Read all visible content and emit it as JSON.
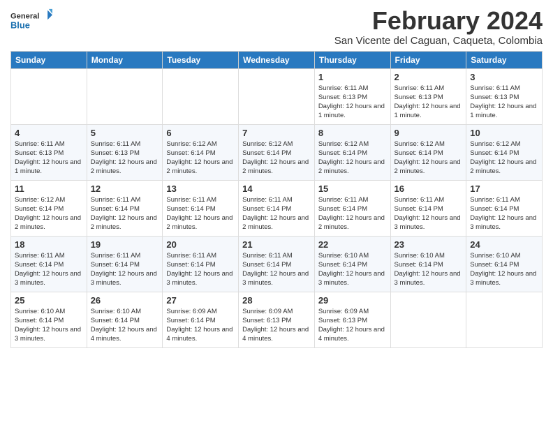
{
  "logo": {
    "line1": "General",
    "line2": "Blue"
  },
  "title": "February 2024",
  "subtitle": "San Vicente del Caguan, Caqueta, Colombia",
  "days_of_week": [
    "Sunday",
    "Monday",
    "Tuesday",
    "Wednesday",
    "Thursday",
    "Friday",
    "Saturday"
  ],
  "weeks": [
    [
      {
        "day": "",
        "info": ""
      },
      {
        "day": "",
        "info": ""
      },
      {
        "day": "",
        "info": ""
      },
      {
        "day": "",
        "info": ""
      },
      {
        "day": "1",
        "info": "Sunrise: 6:11 AM\nSunset: 6:13 PM\nDaylight: 12 hours and 1 minute."
      },
      {
        "day": "2",
        "info": "Sunrise: 6:11 AM\nSunset: 6:13 PM\nDaylight: 12 hours and 1 minute."
      },
      {
        "day": "3",
        "info": "Sunrise: 6:11 AM\nSunset: 6:13 PM\nDaylight: 12 hours and 1 minute."
      }
    ],
    [
      {
        "day": "4",
        "info": "Sunrise: 6:11 AM\nSunset: 6:13 PM\nDaylight: 12 hours and 1 minute."
      },
      {
        "day": "5",
        "info": "Sunrise: 6:11 AM\nSunset: 6:13 PM\nDaylight: 12 hours and 2 minutes."
      },
      {
        "day": "6",
        "info": "Sunrise: 6:12 AM\nSunset: 6:14 PM\nDaylight: 12 hours and 2 minutes."
      },
      {
        "day": "7",
        "info": "Sunrise: 6:12 AM\nSunset: 6:14 PM\nDaylight: 12 hours and 2 minutes."
      },
      {
        "day": "8",
        "info": "Sunrise: 6:12 AM\nSunset: 6:14 PM\nDaylight: 12 hours and 2 minutes."
      },
      {
        "day": "9",
        "info": "Sunrise: 6:12 AM\nSunset: 6:14 PM\nDaylight: 12 hours and 2 minutes."
      },
      {
        "day": "10",
        "info": "Sunrise: 6:12 AM\nSunset: 6:14 PM\nDaylight: 12 hours and 2 minutes."
      }
    ],
    [
      {
        "day": "11",
        "info": "Sunrise: 6:12 AM\nSunset: 6:14 PM\nDaylight: 12 hours and 2 minutes."
      },
      {
        "day": "12",
        "info": "Sunrise: 6:11 AM\nSunset: 6:14 PM\nDaylight: 12 hours and 2 minutes."
      },
      {
        "day": "13",
        "info": "Sunrise: 6:11 AM\nSunset: 6:14 PM\nDaylight: 12 hours and 2 minutes."
      },
      {
        "day": "14",
        "info": "Sunrise: 6:11 AM\nSunset: 6:14 PM\nDaylight: 12 hours and 2 minutes."
      },
      {
        "day": "15",
        "info": "Sunrise: 6:11 AM\nSunset: 6:14 PM\nDaylight: 12 hours and 2 minutes."
      },
      {
        "day": "16",
        "info": "Sunrise: 6:11 AM\nSunset: 6:14 PM\nDaylight: 12 hours and 3 minutes."
      },
      {
        "day": "17",
        "info": "Sunrise: 6:11 AM\nSunset: 6:14 PM\nDaylight: 12 hours and 3 minutes."
      }
    ],
    [
      {
        "day": "18",
        "info": "Sunrise: 6:11 AM\nSunset: 6:14 PM\nDaylight: 12 hours and 3 minutes."
      },
      {
        "day": "19",
        "info": "Sunrise: 6:11 AM\nSunset: 6:14 PM\nDaylight: 12 hours and 3 minutes."
      },
      {
        "day": "20",
        "info": "Sunrise: 6:11 AM\nSunset: 6:14 PM\nDaylight: 12 hours and 3 minutes."
      },
      {
        "day": "21",
        "info": "Sunrise: 6:11 AM\nSunset: 6:14 PM\nDaylight: 12 hours and 3 minutes."
      },
      {
        "day": "22",
        "info": "Sunrise: 6:10 AM\nSunset: 6:14 PM\nDaylight: 12 hours and 3 minutes."
      },
      {
        "day": "23",
        "info": "Sunrise: 6:10 AM\nSunset: 6:14 PM\nDaylight: 12 hours and 3 minutes."
      },
      {
        "day": "24",
        "info": "Sunrise: 6:10 AM\nSunset: 6:14 PM\nDaylight: 12 hours and 3 minutes."
      }
    ],
    [
      {
        "day": "25",
        "info": "Sunrise: 6:10 AM\nSunset: 6:14 PM\nDaylight: 12 hours and 3 minutes."
      },
      {
        "day": "26",
        "info": "Sunrise: 6:10 AM\nSunset: 6:14 PM\nDaylight: 12 hours and 4 minutes."
      },
      {
        "day": "27",
        "info": "Sunrise: 6:09 AM\nSunset: 6:14 PM\nDaylight: 12 hours and 4 minutes."
      },
      {
        "day": "28",
        "info": "Sunrise: 6:09 AM\nSunset: 6:13 PM\nDaylight: 12 hours and 4 minutes."
      },
      {
        "day": "29",
        "info": "Sunrise: 6:09 AM\nSunset: 6:13 PM\nDaylight: 12 hours and 4 minutes."
      },
      {
        "day": "",
        "info": ""
      },
      {
        "day": "",
        "info": ""
      }
    ]
  ]
}
